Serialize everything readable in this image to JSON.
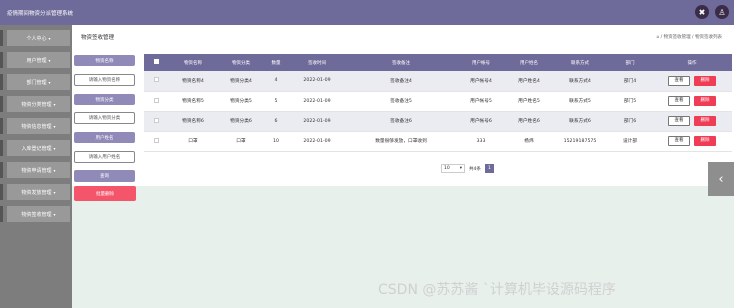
{
  "app": {
    "title": "疫情期间物资分派管理系统"
  },
  "topbar": {
    "icons": [
      "close-circle-icon",
      "user-icon"
    ]
  },
  "sidebar": {
    "items": [
      {
        "label": "个人中心"
      },
      {
        "label": "用户管理"
      },
      {
        "label": "部门管理"
      },
      {
        "label": "物资分类管理"
      },
      {
        "label": "物资信息管理"
      },
      {
        "label": "入库登记管理"
      },
      {
        "label": "物资申请管理"
      },
      {
        "label": "物资发放管理"
      },
      {
        "label": "物资签收管理"
      }
    ]
  },
  "header": {
    "title": "物资签收管理",
    "breadcrumb": "⌂ / 物资签收管理 / 物资签收列表"
  },
  "filters": [
    {
      "label": "物资名称",
      "placeholder": "请输入物资名称"
    },
    {
      "label": "物资分类",
      "placeholder": "请输入物资分类"
    },
    {
      "label": "用户姓名",
      "placeholder": "请输入用户姓名"
    }
  ],
  "buttons": {
    "search": "查询",
    "bulk_delete": "批量删除",
    "view": "查看",
    "delete": "删除"
  },
  "table": {
    "columns": [
      "物资名称",
      "物资分类",
      "数量",
      "签收时间",
      "签收备注",
      "用户帐号",
      "用户姓名",
      "联系方式",
      "部门",
      "操作"
    ],
    "rows": [
      [
        "物资名称4",
        "物资分类4",
        "4",
        "2022-01-09",
        "签收备注4",
        "用户帐号4",
        "用户姓名4",
        "联系方式4",
        "部门4"
      ],
      [
        "物资名称5",
        "物资分类5",
        "5",
        "2022-01-09",
        "签收备注5",
        "用户帐号5",
        "用户姓名5",
        "联系方式5",
        "部门5"
      ],
      [
        "物资名称6",
        "物资分类6",
        "6",
        "2022-01-09",
        "签收备注6",
        "用户帐号6",
        "用户姓名6",
        "联系方式6",
        "部门6"
      ],
      [
        "口罩",
        "口罩",
        "10",
        "2022-01-09",
        "数量很够发放，口罩收到",
        "333",
        "杨炜",
        "15219187575",
        "设计部"
      ]
    ]
  },
  "pager": {
    "page_size": "10",
    "total": "共4条",
    "current_page": "1"
  },
  "watermark": "CSDN @苏苏酱 `计算机毕设源码程序"
}
